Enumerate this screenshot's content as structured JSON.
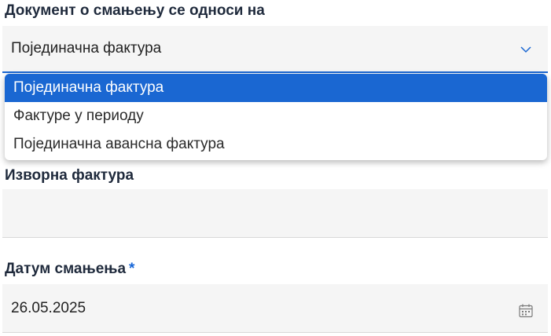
{
  "document_type": {
    "label": "Документ о смањењу се односи на",
    "value": "Појединачна фактура",
    "icon": "chevron-down-icon",
    "options": [
      "Појединачна фактура",
      "Фактуре у периоду",
      "Појединачна авансна фактура"
    ],
    "selected_index": 0
  },
  "source_invoice": {
    "label": "Изворна фактура",
    "value": ""
  },
  "reduction_date": {
    "label": "Датум смањења",
    "required_marker": "*",
    "value": "26.05.2025",
    "icon": "calendar-icon"
  },
  "colors": {
    "accent": "#1a67d2",
    "field_bg": "#f5f5f5",
    "label_text": "#1f2a3c"
  }
}
